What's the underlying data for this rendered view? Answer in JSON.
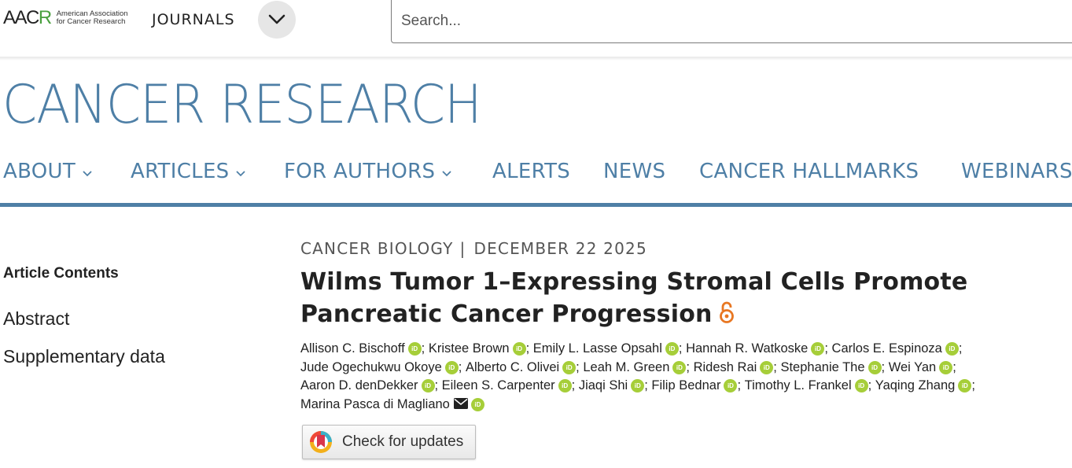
{
  "header": {
    "logo_mark": "AACR",
    "logo_line1": "American Association",
    "logo_line2": "for Cancer Research",
    "journals_label": "JOURNALS",
    "search_placeholder": "Search..."
  },
  "journal": {
    "title": "CANCER RESEARCH"
  },
  "nav": {
    "items": [
      {
        "label": "ABOUT",
        "has_dropdown": true
      },
      {
        "label": "ARTICLES",
        "has_dropdown": true
      },
      {
        "label": "FOR AUTHORS",
        "has_dropdown": true
      },
      {
        "label": "ALERTS",
        "has_dropdown": false
      },
      {
        "label": "NEWS",
        "has_dropdown": false
      },
      {
        "label": "CANCER HALLMARKS",
        "has_dropdown": false
      },
      {
        "label": "WEBINARS",
        "has_dropdown": false
      }
    ]
  },
  "sidebar": {
    "heading": "Article Contents",
    "links": [
      "Abstract",
      "Supplementary data"
    ]
  },
  "article": {
    "category": "CANCER BIOLOGY",
    "separator": "|",
    "date": "DECEMBER 22 2025",
    "title": "Wilms Tumor 1–Expressing Stromal Cells Promote Pancreatic Cancer Progression",
    "open_access_icon": "open-lock-icon",
    "authors": [
      "Allison C. Bischoff",
      "Kristee Brown",
      "Emily L. Lasse Opsahl",
      "Hannah R. Watkoske",
      "Carlos E. Espinoza",
      "Jude Ogechukwu Okoye",
      "Alberto C. Olivei",
      "Leah M. Green",
      "Ridesh Rai",
      "Stephanie The",
      "Wei Yan",
      "Aaron D. denDekker",
      "Eileen S. Carpenter",
      "Jiaqi Shi",
      "Filip Bednar",
      "Timothy L. Frankel",
      "Yaqing Zhang",
      "Marina Pasca di Magliano"
    ],
    "orcid_badge": "iD",
    "check_updates_label": "Check for updates"
  },
  "colors": {
    "brand_blue": "#4e7fa6",
    "orcid_green": "#a6ce39",
    "open_access_orange": "#e87722",
    "aacr_green": "#4aa03f"
  }
}
